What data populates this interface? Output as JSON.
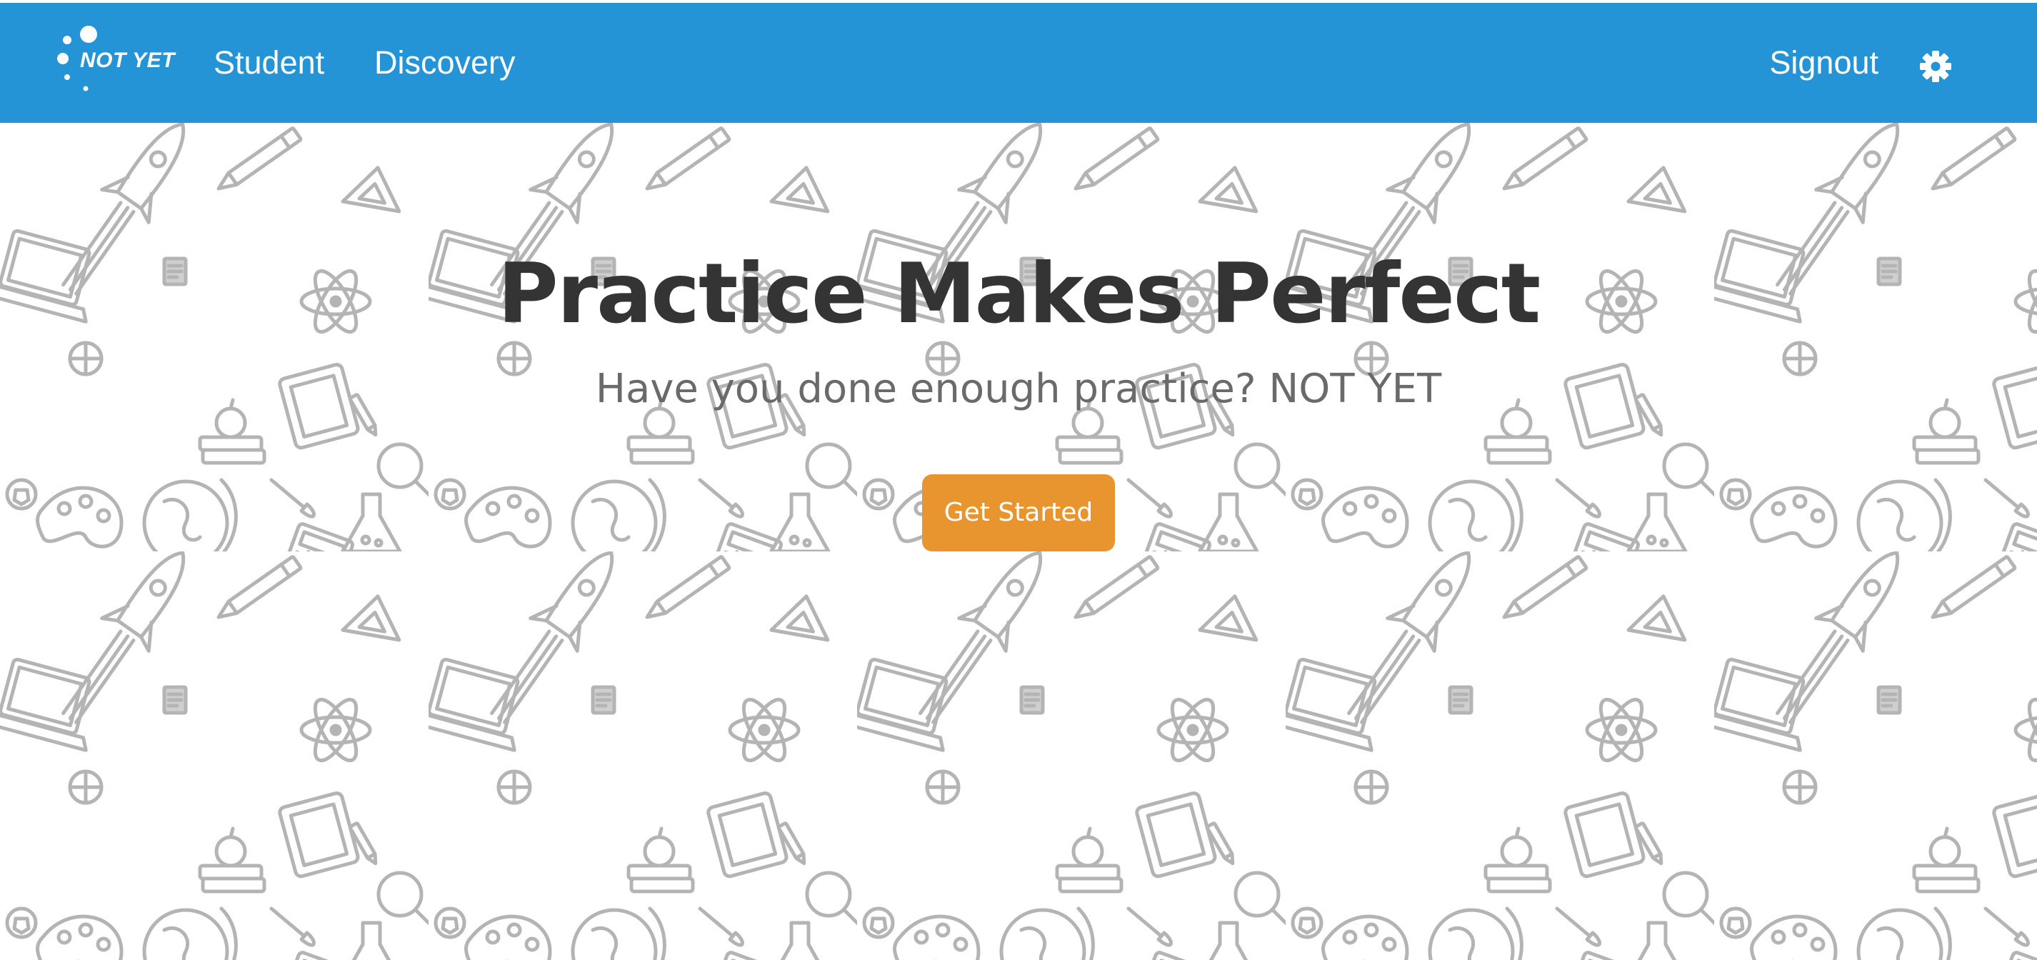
{
  "navbar": {
    "brand": {
      "logo_text": "NOT YET",
      "icon": "dots-logo-icon"
    },
    "links": [
      {
        "label": "Student"
      },
      {
        "label": "Discovery"
      }
    ],
    "signout_label": "Signout",
    "settings_icon": "gear-icon",
    "background_color": "#2494d6"
  },
  "hero": {
    "title": "Practice Makes Perfect",
    "subtitle": "Have you done enough practice? NOT YET",
    "cta_label": "Get Started",
    "cta_color": "#e8952f",
    "background_pattern": "school-doodle-pattern"
  }
}
